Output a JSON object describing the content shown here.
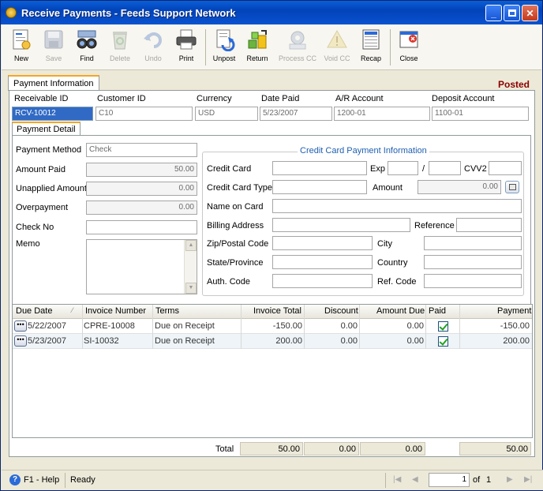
{
  "window": {
    "title": "Receive Payments - Feeds Support Network"
  },
  "toolbar": {
    "new": "New",
    "save": "Save",
    "find": "Find",
    "delete": "Delete",
    "undo": "Undo",
    "print": "Print",
    "unpost": "Unpost",
    "return": "Return",
    "process_cc": "Process CC",
    "void_cc": "Void CC",
    "recap": "Recap",
    "close": "Close"
  },
  "tabs": {
    "payment_information": "Payment Information",
    "payment_detail": "Payment Detail"
  },
  "status_label": "Posted",
  "header": {
    "receivable_id_label": "Receivable ID",
    "receivable_id": "RCV-10012",
    "customer_id_label": "Customer ID",
    "customer_id": "C10",
    "currency_label": "Currency",
    "currency": "USD",
    "date_paid_label": "Date Paid",
    "date_paid": "5/23/2007",
    "ar_account_label": "A/R Account",
    "ar_account": "1200-01",
    "deposit_account_label": "Deposit Account",
    "deposit_account": "1100-01"
  },
  "detail": {
    "payment_method_label": "Payment Method",
    "payment_method": "Check",
    "amount_paid_label": "Amount Paid",
    "amount_paid": "50.00",
    "unapplied_label": "Unapplied Amount",
    "unapplied": "0.00",
    "overpayment_label": "Overpayment",
    "overpayment": "0.00",
    "check_no_label": "Check No",
    "check_no": "",
    "memo_label": "Memo"
  },
  "cc": {
    "title": "Credit Card Payment Information",
    "credit_card_label": "Credit Card",
    "exp_label": "Exp",
    "slash": "/",
    "cvv2_label": "CVV2",
    "card_type_label": "Credit Card Type",
    "amount_label": "Amount",
    "amount": "0.00",
    "name_label": "Name on Card",
    "billing_label": "Billing Address",
    "reference_label": "Reference",
    "zip_label": "Zip/Postal Code",
    "city_label": "City",
    "state_label": "State/Province",
    "country_label": "Country",
    "auth_label": "Auth. Code",
    "ref_code_label": "Ref. Code"
  },
  "grid": {
    "columns": {
      "due_date": "Due Date",
      "invoice_number": "Invoice Number",
      "terms": "Terms",
      "invoice_total": "Invoice Total",
      "discount": "Discount",
      "amount_due": "Amount Due",
      "paid": "Paid",
      "payment": "Payment"
    },
    "rows": [
      {
        "due_date": "5/22/2007",
        "invoice_number": "CPRE-10008",
        "terms": "Due on Receipt",
        "invoice_total": "-150.00",
        "discount": "0.00",
        "amount_due": "0.00",
        "payment": "-150.00"
      },
      {
        "due_date": "5/23/2007",
        "invoice_number": "SI-10032",
        "terms": "Due on Receipt",
        "invoice_total": "200.00",
        "discount": "0.00",
        "amount_due": "0.00",
        "payment": "200.00"
      }
    ],
    "ellipsis": "•••"
  },
  "totals": {
    "label": "Total",
    "invoice_total": "50.00",
    "discount": "0.00",
    "amount_due": "0.00",
    "payment": "50.00"
  },
  "statusbar": {
    "help": "F1 - Help",
    "status": "Ready",
    "page": "1",
    "of_label": "of",
    "total_pages": "1"
  }
}
